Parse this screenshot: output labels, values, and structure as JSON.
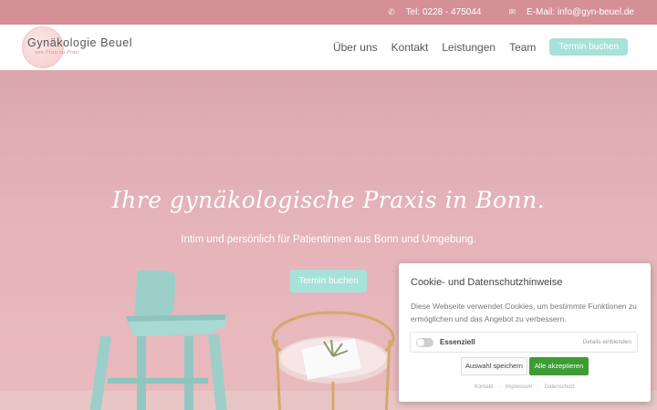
{
  "topbar": {
    "phone_icon": "phone-icon",
    "phone": "Tel: 0228 - 475044",
    "mail_icon": "envelope-icon",
    "email": "E-Mail: info@gyn-beuel.de"
  },
  "header": {
    "logo_title": "Gynäkologie Beuel",
    "logo_sub": "von Frau zu Frau",
    "nav": [
      "Über uns",
      "Kontakt",
      "Leistungen",
      "Team"
    ],
    "book_label": "Termin buchen"
  },
  "hero": {
    "headline": "Ihre gynäkologische Praxis in Bonn.",
    "subline": "Intim und persönlich für Patientinnen aus Bonn und Umgebung.",
    "cta_label": "Termin buchen"
  },
  "cookie": {
    "title": "Cookie- und Datenschutzhinweise",
    "description": "Diese Webseite verwendet Cookies, um bestimmte Funktionen zu ermöglichen und das Angebot zu verbessern.",
    "category_label": "Essenziell",
    "details_label": "Details einblenden",
    "save_label": "Auswahl speichern",
    "accept_label": "Alle akzeptieren",
    "links": [
      "Kontakt",
      "Impressum",
      "Datenschutz"
    ],
    "link_separator": "·"
  },
  "colors": {
    "topbar": "#d49095",
    "accent": "#a6e2d9",
    "accept": "#3f9c35"
  }
}
